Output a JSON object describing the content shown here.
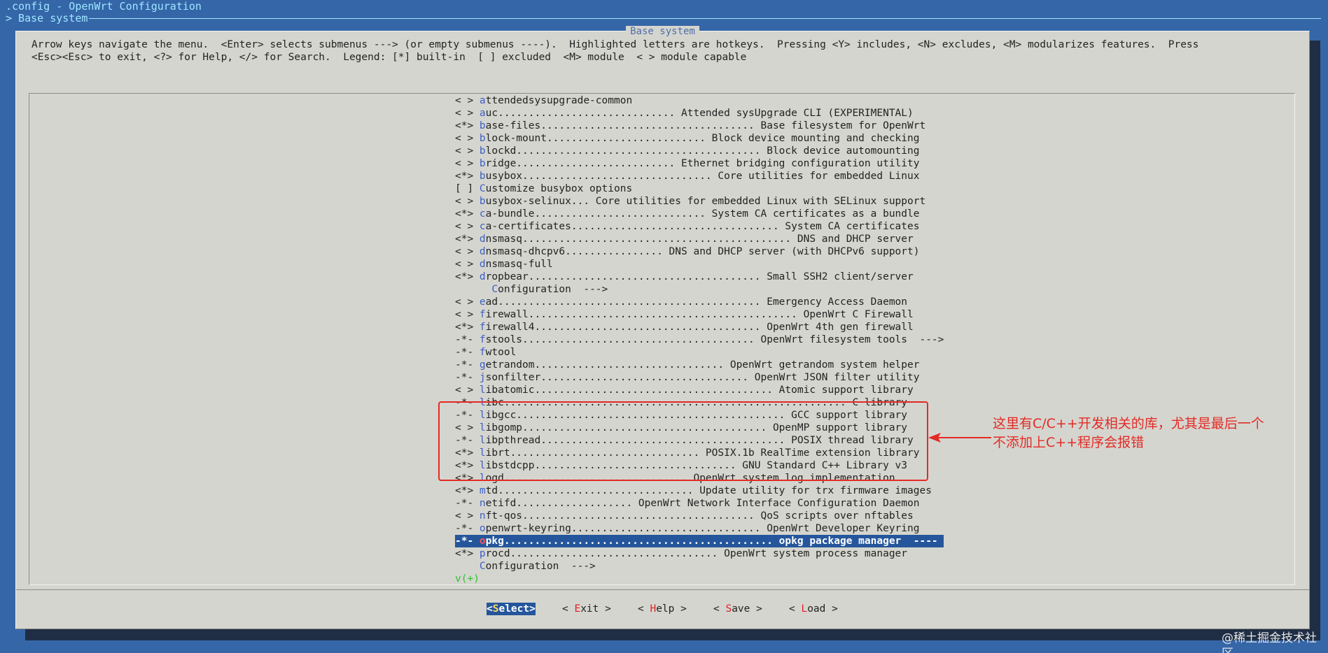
{
  "header": {
    "title": ".config - OpenWrt Configuration",
    "breadcrumb": "> Base system"
  },
  "dialog": {
    "title": "Base system",
    "help_line_1": "Arrow keys navigate the menu.  <Enter> selects submenus ---> (or empty submenus ----).  Highlighted letters are hotkeys.  Pressing <Y> includes, <N> excludes, <M> modularizes features.  Press",
    "help_line_2": "<Esc><Esc> to exit, <?> for Help, </> for Search.  Legend: [*] built-in  [ ] excluded  <M> module  < > module capable"
  },
  "menu": {
    "items": [
      {
        "pre": "< > ",
        "hk": "a",
        "rest": "ttendedsysupgrade-common"
      },
      {
        "pre": "< > ",
        "hk": "a",
        "rest": "uc............................. Attended sysUpgrade CLI (EXPERIMENTAL)"
      },
      {
        "pre": "<*> ",
        "hk": "b",
        "rest": "ase-files................................... Base filesystem for OpenWrt"
      },
      {
        "pre": "< > ",
        "hk": "b",
        "rest": "lock-mount.......................... Block device mounting and checking"
      },
      {
        "pre": "< > ",
        "hk": "b",
        "rest": "lockd........................................ Block device automounting"
      },
      {
        "pre": "< > ",
        "hk": "b",
        "rest": "ridge.......................... Ethernet bridging configuration utility"
      },
      {
        "pre": "<*> ",
        "hk": "b",
        "rest": "usybox............................... Core utilities for embedded Linux"
      },
      {
        "pre": "[ ] ",
        "hk": "C",
        "rest": "ustomize busybox options"
      },
      {
        "pre": "< > ",
        "hk": "b",
        "rest": "usybox-selinux... Core utilities for embedded Linux with SELinux support"
      },
      {
        "pre": "<*> ",
        "hk": "c",
        "rest": "a-bundle............................ System CA certificates as a bundle"
      },
      {
        "pre": "< > ",
        "hk": "c",
        "rest": "a-certificates.................................. System CA certificates"
      },
      {
        "pre": "<*> ",
        "hk": "d",
        "rest": "nsmasq............................................ DNS and DHCP server"
      },
      {
        "pre": "< > ",
        "hk": "d",
        "rest": "nsmasq-dhcpv6................ DNS and DHCP server (with DHCPv6 support)"
      },
      {
        "pre": "< > ",
        "hk": "d",
        "rest": "nsmasq-full"
      },
      {
        "pre": "<*> ",
        "hk": "d",
        "rest": "ropbear...................................... Small SSH2 client/server"
      },
      {
        "pre": "      ",
        "hk": "C",
        "rest": "onfiguration  --->"
      },
      {
        "pre": "< > ",
        "hk": "e",
        "rest": "ad........................................... Emergency Access Daemon"
      },
      {
        "pre": "< > ",
        "hk": "f",
        "rest": "irewall............................................ OpenWrt C Firewall"
      },
      {
        "pre": "<*> ",
        "hk": "f",
        "rest": "irewall4..................................... OpenWrt 4th gen firewall"
      },
      {
        "pre": "-*- ",
        "hk": "f",
        "rest": "stools...................................... OpenWrt filesystem tools  --->"
      },
      {
        "pre": "-*- ",
        "hk": "f",
        "rest": "wtool"
      },
      {
        "pre": "-*- ",
        "hk": "g",
        "rest": "etrandom............................... OpenWrt getrandom system helper"
      },
      {
        "pre": "-*- ",
        "hk": "j",
        "rest": "sonfilter.................................. OpenWrt JSON filter utility"
      },
      {
        "pre": "< > ",
        "hk": "l",
        "rest": "ibatomic....................................... Atomic support library"
      },
      {
        "pre": "-*- ",
        "hk": "l",
        "rest": "ibc........................................................ C library"
      },
      {
        "pre": "-*- ",
        "hk": "l",
        "rest": "ibgcc............................................ GCC support library"
      },
      {
        "pre": "< > ",
        "hk": "l",
        "rest": "ibgomp........................................ OpenMP support library"
      },
      {
        "pre": "-*- ",
        "hk": "l",
        "rest": "ibpthread........................................ POSIX thread library"
      },
      {
        "pre": "<*> ",
        "hk": "l",
        "rest": "ibrt............................... POSIX.1b RealTime extension library"
      },
      {
        "pre": "<*> ",
        "hk": "l",
        "rest": "ibstdcpp................................. GNU Standard C++ Library v3"
      },
      {
        "pre": "<*> ",
        "hk": "l",
        "rest": "ogd.............................. OpenWrt system log implementation"
      },
      {
        "pre": "<*> ",
        "hk": "m",
        "rest": "td................................ Update utility for trx firmware images"
      },
      {
        "pre": "-*- ",
        "hk": "n",
        "rest": "etifd................... OpenWrt Network Interface Configuration Daemon"
      },
      {
        "pre": "< > ",
        "hk": "n",
        "rest": "ft-qos...................................... QoS scripts over nftables"
      },
      {
        "pre": "-*- ",
        "hk": "o",
        "rest": "penwrt-keyring............................... OpenWrt Developer Keyring"
      },
      {
        "pre": "-*- ",
        "hk": "o",
        "rest": "pkg............................................ opkg package manager  ----",
        "selected": true
      },
      {
        "pre": "<*> ",
        "hk": "p",
        "rest": "rocd.................................. OpenWrt system process manager"
      },
      {
        "pre": "    ",
        "hk": "C",
        "rest": "onfiguration  --->"
      }
    ],
    "scroll_indicator": "v(+)"
  },
  "annotation": {
    "line_1": "这里有C/C++开发相关的库，尤其是最后一个",
    "line_2": "不添加上C++程序会报错",
    "color": "#e42a25"
  },
  "buttons": {
    "select": {
      "open": "<",
      "key": "S",
      "rest": "elect>"
    },
    "exit": {
      "open": "< ",
      "key": "E",
      "rest": "xit >"
    },
    "help": {
      "open": "< ",
      "key": "H",
      "rest": "elp >"
    },
    "save": {
      "open": "< ",
      "key": "S",
      "rest": "ave >"
    },
    "load": {
      "open": "< ",
      "key": "L",
      "rest": "oad >"
    }
  },
  "watermark": "@稀土掘金技术社区"
}
